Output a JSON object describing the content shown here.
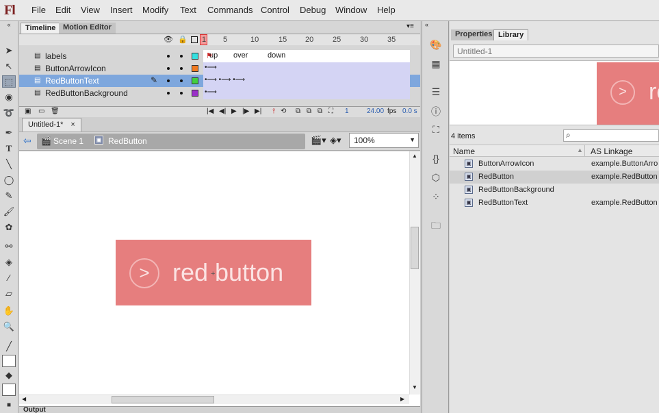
{
  "app": {
    "logo": "Fl"
  },
  "menu": [
    "File",
    "Edit",
    "View",
    "Insert",
    "Modify",
    "Text",
    "Commands",
    "Control",
    "Debug",
    "Window",
    "Help"
  ],
  "tools": {
    "icons": [
      "selection-tool-icon",
      "subselection-tool-icon",
      "free-transform-tool-icon",
      "3d-rotation-tool-icon",
      "lasso-tool-icon",
      "pen-tool-icon",
      "text-tool-icon",
      "line-tool-icon",
      "oval-tool-icon",
      "pencil-tool-icon",
      "brush-tool-icon",
      "deco-tool-icon",
      "bone-tool-icon",
      "paint-bucket-tool-icon",
      "eyedropper-tool-icon",
      "eraser-tool-icon",
      "hand-tool-icon",
      "zoom-tool-icon",
      "stroke-color-icon",
      "fill-color-icon"
    ]
  },
  "timeline": {
    "tabs": [
      "Timeline",
      "Motion Editor"
    ],
    "frame_numbers": [
      "1",
      "5",
      "10",
      "15",
      "20",
      "25",
      "30",
      "35"
    ],
    "layers": [
      {
        "name": "labels",
        "color": "#33e0e0",
        "selected": false
      },
      {
        "name": "ButtonArrowIcon",
        "color": "#f07a20",
        "selected": false
      },
      {
        "name": "RedButtonText",
        "color": "#40d040",
        "selected": true
      },
      {
        "name": "RedButtonBackground",
        "color": "#9a30c8",
        "selected": false
      }
    ],
    "frame_labels": [
      "up",
      "over",
      "down"
    ],
    "current_frame": "1",
    "fps": "24.00",
    "fps_unit": "fps",
    "time": "0.0 s"
  },
  "document": {
    "tab": "Untitled-1*",
    "close": "×",
    "breadcrumbs": [
      "Scene 1",
      "RedButton"
    ],
    "zoom": "100%",
    "stage_button": {
      "arrow": ">",
      "text": "red button",
      "color": "#e67e7e"
    }
  },
  "output_panel": {
    "title": "Output"
  },
  "library": {
    "tabs": [
      "Properties",
      "Library"
    ],
    "document": "Untitled-1",
    "preview_arrow": ">",
    "preview_text": "re",
    "item_count": "4 items",
    "columns": [
      "Name",
      "AS Linkage"
    ],
    "items": [
      {
        "name": "ButtonArrowIcon",
        "linkage": "example.ButtonArro"
      },
      {
        "name": "RedButton",
        "linkage": "example.RedButton"
      },
      {
        "name": "RedButtonBackground",
        "linkage": ""
      },
      {
        "name": "RedButtonText",
        "linkage": "example.RedButton"
      }
    ]
  }
}
